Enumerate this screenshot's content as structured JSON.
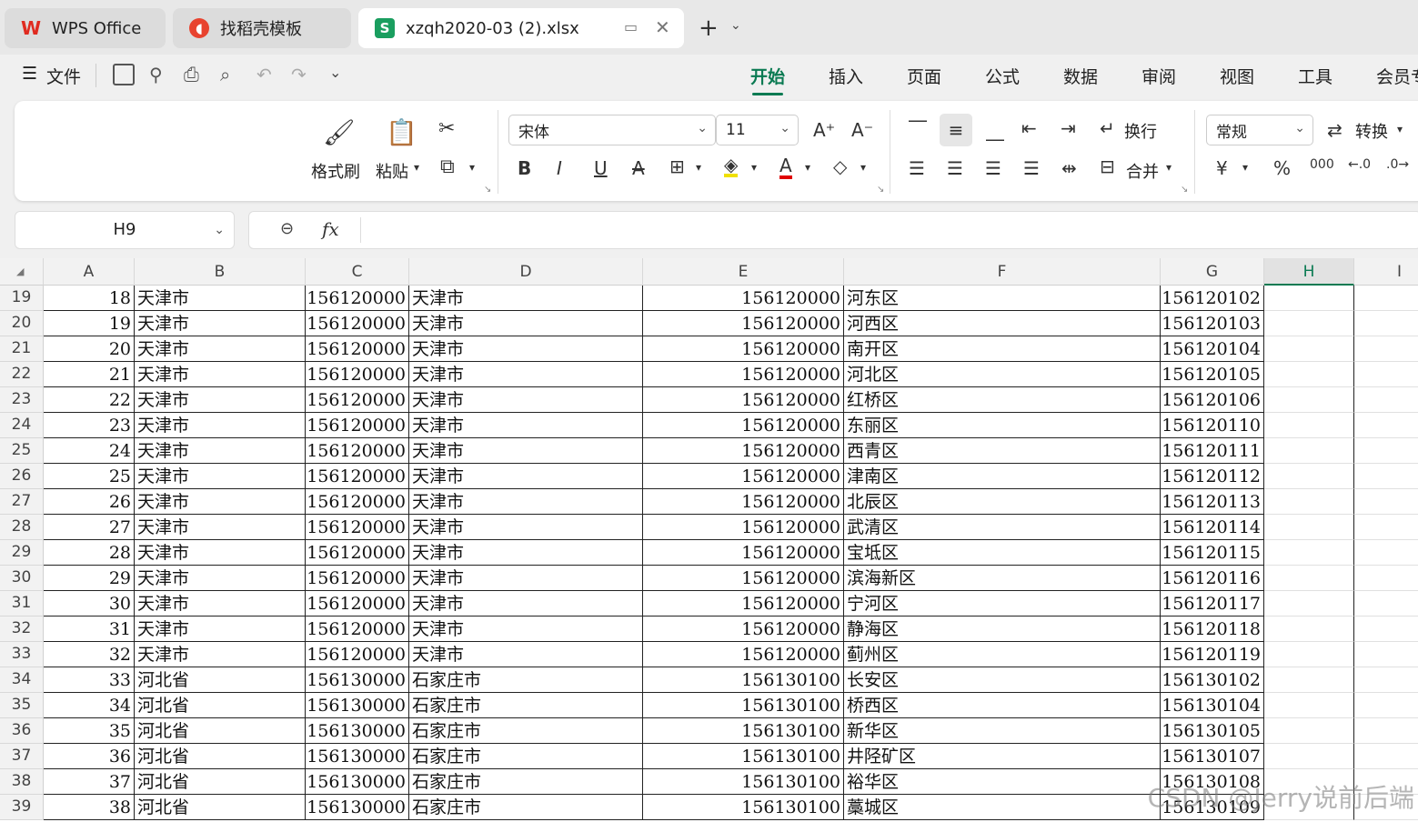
{
  "tabs": [
    {
      "label": "WPS Office"
    },
    {
      "label": "找稻壳模板"
    },
    {
      "label": "xzqh2020-03 (2).xlsx"
    }
  ],
  "menu": {
    "file": "文件"
  },
  "ribbon_tabs": [
    "开始",
    "插入",
    "页面",
    "公式",
    "数据",
    "审阅",
    "视图",
    "工具",
    "会员专"
  ],
  "ribbon": {
    "format_painter": "格式刷",
    "paste": "粘贴",
    "font_name": "宋体",
    "font_size": "11",
    "wrap": "换行",
    "merge": "合并",
    "number_format": "常规",
    "convert": "转换"
  },
  "name_box": "H9",
  "fx": "fx",
  "columns": [
    "A",
    "B",
    "C",
    "D",
    "E",
    "F",
    "G",
    "H",
    "I"
  ],
  "rows": [
    {
      "n": "19",
      "a": "18",
      "b": "天津市",
      "c": "156120000",
      "d": "天津市",
      "e": "156120000",
      "f": "河东区",
      "g": "156120102"
    },
    {
      "n": "20",
      "a": "19",
      "b": "天津市",
      "c": "156120000",
      "d": "天津市",
      "e": "156120000",
      "f": "河西区",
      "g": "156120103"
    },
    {
      "n": "21",
      "a": "20",
      "b": "天津市",
      "c": "156120000",
      "d": "天津市",
      "e": "156120000",
      "f": "南开区",
      "g": "156120104"
    },
    {
      "n": "22",
      "a": "21",
      "b": "天津市",
      "c": "156120000",
      "d": "天津市",
      "e": "156120000",
      "f": "河北区",
      "g": "156120105"
    },
    {
      "n": "23",
      "a": "22",
      "b": "天津市",
      "c": "156120000",
      "d": "天津市",
      "e": "156120000",
      "f": "红桥区",
      "g": "156120106"
    },
    {
      "n": "24",
      "a": "23",
      "b": "天津市",
      "c": "156120000",
      "d": "天津市",
      "e": "156120000",
      "f": "东丽区",
      "g": "156120110"
    },
    {
      "n": "25",
      "a": "24",
      "b": "天津市",
      "c": "156120000",
      "d": "天津市",
      "e": "156120000",
      "f": "西青区",
      "g": "156120111"
    },
    {
      "n": "26",
      "a": "25",
      "b": "天津市",
      "c": "156120000",
      "d": "天津市",
      "e": "156120000",
      "f": "津南区",
      "g": "156120112"
    },
    {
      "n": "27",
      "a": "26",
      "b": "天津市",
      "c": "156120000",
      "d": "天津市",
      "e": "156120000",
      "f": "北辰区",
      "g": "156120113"
    },
    {
      "n": "28",
      "a": "27",
      "b": "天津市",
      "c": "156120000",
      "d": "天津市",
      "e": "156120000",
      "f": "武清区",
      "g": "156120114"
    },
    {
      "n": "29",
      "a": "28",
      "b": "天津市",
      "c": "156120000",
      "d": "天津市",
      "e": "156120000",
      "f": "宝坻区",
      "g": "156120115"
    },
    {
      "n": "30",
      "a": "29",
      "b": "天津市",
      "c": "156120000",
      "d": "天津市",
      "e": "156120000",
      "f": "滨海新区",
      "g": "156120116"
    },
    {
      "n": "31",
      "a": "30",
      "b": "天津市",
      "c": "156120000",
      "d": "天津市",
      "e": "156120000",
      "f": "宁河区",
      "g": "156120117"
    },
    {
      "n": "32",
      "a": "31",
      "b": "天津市",
      "c": "156120000",
      "d": "天津市",
      "e": "156120000",
      "f": "静海区",
      "g": "156120118"
    },
    {
      "n": "33",
      "a": "32",
      "b": "天津市",
      "c": "156120000",
      "d": "天津市",
      "e": "156120000",
      "f": "蓟州区",
      "g": "156120119"
    },
    {
      "n": "34",
      "a": "33",
      "b": "河北省",
      "c": "156130000",
      "d": "石家庄市",
      "e": "156130100",
      "f": "长安区",
      "g": "156130102"
    },
    {
      "n": "35",
      "a": "34",
      "b": "河北省",
      "c": "156130000",
      "d": "石家庄市",
      "e": "156130100",
      "f": "桥西区",
      "g": "156130104"
    },
    {
      "n": "36",
      "a": "35",
      "b": "河北省",
      "c": "156130000",
      "d": "石家庄市",
      "e": "156130100",
      "f": "新华区",
      "g": "156130105"
    },
    {
      "n": "37",
      "a": "36",
      "b": "河北省",
      "c": "156130000",
      "d": "石家庄市",
      "e": "156130100",
      "f": "井陉矿区",
      "g": "156130107"
    },
    {
      "n": "38",
      "a": "37",
      "b": "河北省",
      "c": "156130000",
      "d": "石家庄市",
      "e": "156130100",
      "f": "裕华区",
      "g": "156130108"
    },
    {
      "n": "39",
      "a": "38",
      "b": "河北省",
      "c": "156130000",
      "d": "石家庄市",
      "e": "156130100",
      "f": "藁城区",
      "g": "156130109"
    }
  ],
  "watermark": "CSDN @Jerry说前后端",
  "colors": {
    "accent": "#0a7a52",
    "wps_red": "#e02b20",
    "sheet_green": "#1a9e5f"
  }
}
